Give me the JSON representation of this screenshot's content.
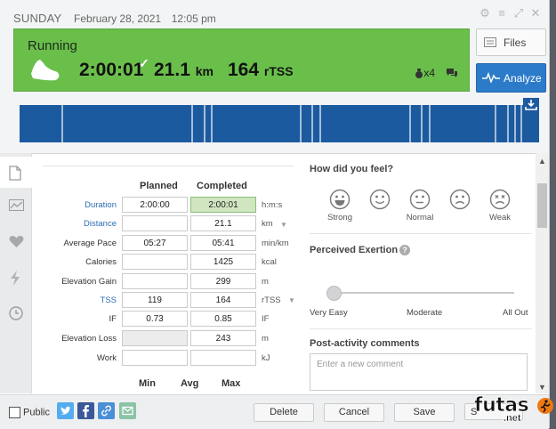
{
  "header": {
    "day": "SUNDAY",
    "date": "February 28, 2021",
    "time": "12:05 pm"
  },
  "banner": {
    "sport": "Running",
    "duration": "2:00:01",
    "distance_value": "21.1",
    "distance_unit": "km",
    "tss_value": "164",
    "tss_unit": "rTSS",
    "multiplier": "x4"
  },
  "buttons": {
    "files": "Files",
    "analyze": "Analyze"
  },
  "colors": {
    "banner": "#6abf4b",
    "graph": "#1c5aa0",
    "analyze": "#2c7bc9"
  },
  "table": {
    "col_planned": "Planned",
    "col_completed": "Completed",
    "rows": [
      {
        "label": "Duration",
        "planned": "2:00:00",
        "completed": "2:00:01",
        "unit": "h:m:s"
      },
      {
        "label": "Distance",
        "planned": "",
        "completed": "21.1",
        "unit": "km"
      },
      {
        "label": "Average Pace",
        "planned": "05:27",
        "completed": "05:41",
        "unit": "min/km"
      },
      {
        "label": "Calories",
        "planned": "",
        "completed": "1425",
        "unit": "kcal"
      },
      {
        "label": "Elevation Gain",
        "planned": "",
        "completed": "299",
        "unit": "m"
      },
      {
        "label": "TSS",
        "planned": "119",
        "completed": "164",
        "unit": "rTSS"
      },
      {
        "label": "IF",
        "planned": "0.73",
        "completed": "0.85",
        "unit": "IF"
      },
      {
        "label": "Elevation Loss",
        "planned": "",
        "completed": "243",
        "unit": "m"
      },
      {
        "label": "Work",
        "planned": "",
        "completed": "",
        "unit": "kJ"
      }
    ],
    "min": "Min",
    "avg": "Avg",
    "max": "Max"
  },
  "feel": {
    "title": "How did you feel?",
    "options": [
      "Strong",
      "",
      "Normal",
      "",
      "Weak"
    ]
  },
  "exertion": {
    "title": "Perceived Exertion",
    "help": "?",
    "low": "Very Easy",
    "mid": "Moderate",
    "high": "All Out",
    "level": 0
  },
  "comments": {
    "title": "Post-activity comments",
    "placeholder": "Enter a new comment"
  },
  "footer": {
    "public": "Public",
    "delete": "Delete",
    "cancel": "Cancel",
    "save": "Save",
    "save_close": "S"
  },
  "watermark": {
    "text": "futas",
    "suffix": ".net"
  }
}
